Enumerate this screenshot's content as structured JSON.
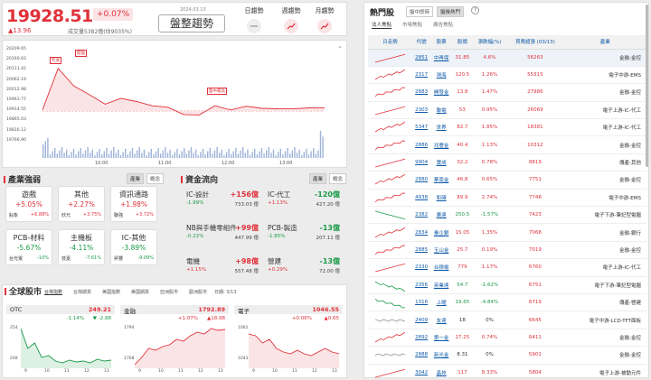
{
  "header": {
    "index_value": "19928.51",
    "change_pct": "+0.07%",
    "change_pts": "▲13.96",
    "volume": "成交量5382億(估9035%)",
    "date": "2024.03.13",
    "trend": "盤整趨勢",
    "timeframes": [
      "日趨勢",
      "週趨勢",
      "月趨勢"
    ]
  },
  "main_chart": {
    "y_ticks": [
      "20209.65",
      "20160.63",
      "20111.42",
      "20062.19",
      "20012.98",
      "19963.77",
      "19914.55",
      "19865.03",
      "19816.12",
      "19766.90"
    ],
    "x_ticks": [
      "10:00",
      "11:00",
      "12:00",
      "13:00"
    ],
    "tags": [
      "昨收",
      "開盤",
      "盤中最高",
      "最低"
    ],
    "toggle_icon": "chevron-down-icon"
  },
  "chart_data": {
    "type": "line",
    "title": "",
    "x": [
      "09:00",
      "09:15",
      "09:30",
      "09:45",
      "10:00",
      "10:15",
      "10:30",
      "10:45",
      "11:00",
      "11:15",
      "11:30",
      "11:45",
      "12:00",
      "12:15",
      "12:30",
      "12:45",
      "13:00",
      "13:15",
      "13:30"
    ],
    "series": [
      {
        "name": "",
        "values": [
          19915,
          20120,
          20040,
          19990,
          19950,
          19970,
          19960,
          19945,
          19930,
          19900,
          19890,
          19940,
          19925,
          19935,
          19930,
          19920,
          19925,
          19935,
          19928
        ]
      }
    ],
    "ylim": [
      19766.9,
      20209.65
    ],
    "grid": false
  },
  "industry": {
    "title": "產業強弱",
    "toggles": [
      "產業",
      "概念"
    ],
    "cards": [
      {
        "name": "遊戲",
        "pct": "+5.05%",
        "stock": "鈊象",
        "chg": "+6.88%",
        "up": true
      },
      {
        "name": "其他",
        "pct": "+2.27%",
        "stock": "欣元",
        "chg": "+3.75%",
        "up": true
      },
      {
        "name": "資訊通路",
        "pct": "+1.98%",
        "stock": "聯強",
        "chg": "+3.72%",
        "up": true
      },
      {
        "name": "PCB-材料",
        "pct": "-5.67%",
        "stock": "台光電",
        "chg": "-10%",
        "up": false
      },
      {
        "name": "主機板",
        "pct": "-4.11%",
        "stock": "技嘉",
        "chg": "-7.61%",
        "up": false
      },
      {
        "name": "IC-其他",
        "pct": "-3.89%",
        "stock": "昇豐",
        "chg": "-9.09%",
        "up": false
      }
    ]
  },
  "capital": {
    "title": "資金流向",
    "toggles": [
      "產業",
      "概念"
    ],
    "cards": [
      {
        "name": "IC-設計",
        "amt": "+156億",
        "pct": "-1.99%",
        "val": "733.03 億",
        "up": true,
        "pup": false
      },
      {
        "name": "IC-代工",
        "amt": "-120億",
        "pct": "+1.13%",
        "val": "427.20 億",
        "up": false,
        "pup": true
      },
      {
        "name": "NB與手機零組件",
        "amt": "+99億",
        "pct": "-0.22%",
        "val": "447.99 億",
        "up": true,
        "pup": false
      },
      {
        "name": "PCB-製造",
        "amt": "-13億",
        "pct": "-1.85%",
        "val": "207.11 億",
        "up": false,
        "pup": false
      },
      {
        "name": "電機",
        "amt": "+98億",
        "pct": "+1.15%",
        "val": "557.48 億",
        "up": true,
        "pup": true
      },
      {
        "name": "營建",
        "amt": "-13億",
        "pct": "+0.29%",
        "val": "72.00 億",
        "up": false,
        "pup": true
      }
    ]
  },
  "global": {
    "title": "全球股市",
    "date": "日期: 3/13",
    "tabs": [
      "台灣指數",
      "台灣期貨",
      "美國指數",
      "美國期貨",
      "亞洲股市",
      "歐洲股市"
    ],
    "charts": [
      {
        "name": "OTC",
        "value": "249.21",
        "pct": "-1.14%",
        "chg": "▼ -2.88",
        "up": false,
        "ymax": "254",
        "ymin": "248"
      },
      {
        "name": "金融",
        "value": "1792.89",
        "pct": "+1.07%",
        "chg": "▲18.98",
        "up": true,
        "ymax": "1794",
        "ymin": "1768"
      },
      {
        "name": "電子",
        "value": "1046.55",
        "pct": "+0.06%",
        "chg": "▲0.65",
        "up": true,
        "ymax": "1061",
        "ymin": "1043"
      }
    ],
    "xt": [
      "9",
      "10",
      "11",
      "12",
      "13"
    ]
  },
  "hot": {
    "title": "熱門股",
    "tabs": [
      "盤中即時",
      "盤後熱門"
    ],
    "help_icon": "question-icon",
    "subtabs": [
      "法人焦點",
      "市場焦點",
      "廣告焦點"
    ],
    "columns": [
      "日走勢",
      "代號",
      "股票",
      "股價",
      "漲跌幅(%)",
      "買賣超張\n(03/13)",
      "產業"
    ],
    "rows": [
      [
        "2851",
        "中再保",
        "31.85",
        "4.6%",
        "56263",
        "金融-金控",
        "up"
      ],
      [
        "2317",
        "鴻海",
        "120.5",
        "1.26%",
        "55315",
        "電子中游-EMS",
        "up"
      ],
      [
        "2883",
        "開發金",
        "13.8",
        "1.47%",
        "27986",
        "金融-金控",
        "up"
      ],
      [
        "2303",
        "聯電",
        "53",
        "0.95%",
        "26069",
        "電子上游-IC-代工",
        "up"
      ],
      [
        "5347",
        "世界",
        "82.7",
        "1.85%",
        "18381",
        "電子上游-IC-代工",
        "up"
      ],
      [
        "2886",
        "兆豐金",
        "40.4",
        "1.13%",
        "10312",
        "金融-金控",
        "up"
      ],
      [
        "9904",
        "寶成",
        "32.2",
        "0.78%",
        "8819",
        "傳產-其他",
        "up"
      ],
      [
        "2880",
        "華南金",
        "46.8",
        "0.65%",
        "7751",
        "金融-金控",
        "up"
      ],
      [
        "4938",
        "和碩",
        "89.9",
        "2.74%",
        "7748",
        "電子中游-EMS",
        "up"
      ],
      [
        "2382",
        "廣達",
        "250.5",
        "-1.57%",
        "7423",
        "電子下游-筆記型電腦",
        "down"
      ],
      [
        "2834",
        "臺企銀",
        "15.05",
        "1.35%",
        "7068",
        "金融-銀行",
        "up"
      ],
      [
        "2885",
        "玉山金",
        "25.7",
        "0.19%",
        "7019",
        "金融-金控",
        "up"
      ],
      [
        "2330",
        "台積電",
        "779",
        "1.17%",
        "6760",
        "電子上游-IC-代工",
        "up"
      ],
      [
        "2356",
        "英業達",
        "54.7",
        "-1.62%",
        "6751",
        "電子下游-筆記型電腦",
        "down"
      ],
      [
        "1316",
        "上曜",
        "19.65",
        "-4.84%",
        "6719",
        "傳產-營建",
        "down"
      ],
      [
        "2409",
        "友達",
        "18",
        "0%",
        "6645",
        "電子中游-LCD-TFT面板",
        "flat"
      ],
      [
        "2892",
        "第一金",
        "27.25",
        "0.74%",
        "6411",
        "金融-金控",
        "up"
      ],
      [
        "2888",
        "新光金",
        "8.31",
        "0%",
        "5901",
        "金融-金控",
        "flat"
      ],
      [
        "3042",
        "晶技",
        "117",
        "8.33%",
        "5804",
        "電子上游-被動元件",
        "up"
      ]
    ]
  },
  "colors": {
    "up": "#e0313a",
    "down": "#1a9a48",
    "link": "#0e5aa8"
  }
}
